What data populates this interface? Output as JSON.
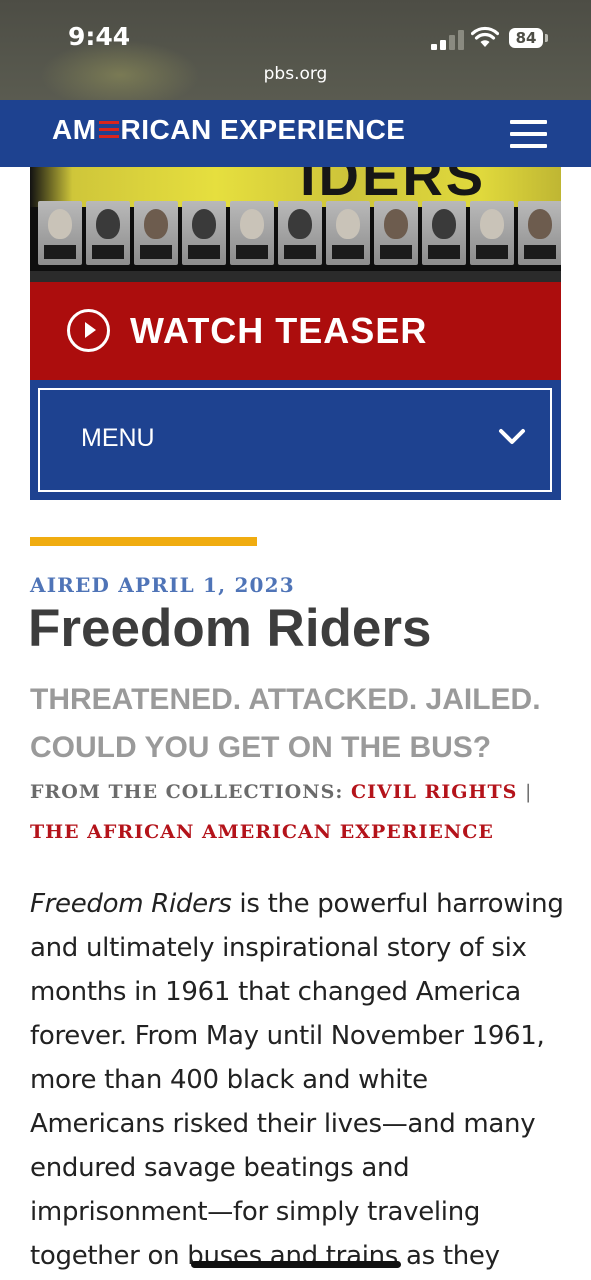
{
  "status_bar": {
    "time": "9:44",
    "battery": "84",
    "url": "pbs.org"
  },
  "header": {
    "logo_part1": "AM",
    "logo_part2": "RICAN EXPERIENCE",
    "brand_color": "#1e4290",
    "flag_color": "#d9251d"
  },
  "hero": {
    "title_fragment": "IDERS"
  },
  "teaser": {
    "label": "WATCH TEASER",
    "color": "#ac0d0d"
  },
  "menu": {
    "label": "MENU"
  },
  "article": {
    "aired": "AIRED APRIL 1, 2023",
    "title": "Freedom Riders",
    "subtitle": "THREATENED. ATTACKED. JAILED. COULD YOU GET ON THE BUS?",
    "collections_prefix": "FROM THE COLLECTIONS:",
    "collection_1": "CIVIL RIGHTS",
    "separator": "|",
    "collection_2": "THE AFRICAN AMERICAN EXPERIENCE",
    "body_italic": "Freedom Riders",
    "body_rest": " is the powerful harrowing and ultimately inspirational story of six months in 1961 that changed America forever. From May until November 1961, more than 400 black and white Americans risked their lives—and many endured savage beatings and imprisonment—for simply traveling together on buses and trains as they",
    "accent_color": "#f0ac10"
  }
}
